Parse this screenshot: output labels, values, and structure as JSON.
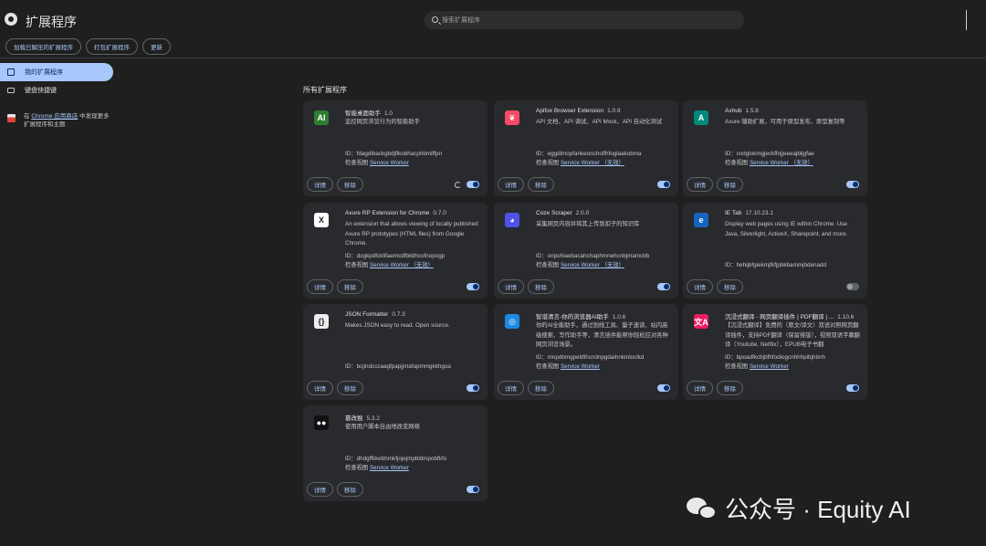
{
  "header": {
    "title": "扩展程序",
    "search_placeholder": "搜索扩展程序"
  },
  "dev_toolbar": {
    "load_unpacked": "加载已解压的扩展程序",
    "pack": "打包扩展程序",
    "update": "更新"
  },
  "sidebar": {
    "items": [
      {
        "label": "我的扩展程序"
      },
      {
        "label": "键盘快捷键"
      }
    ],
    "store_prefix": "在",
    "store_link": "Chrome 应用商店",
    "store_suffix": "中发现更多扩展程序和主题"
  },
  "section_title": "所有扩展程序",
  "labels": {
    "details": "详情",
    "remove": "移除",
    "id_prefix": "ID：",
    "inspect_prefix": "检查视图"
  },
  "extensions": [
    {
      "name": "智能桌面助手",
      "version": "1.0",
      "desc": "监控网页浏览行为的智能助手",
      "id": "fdagdibackgbdjflkobhacphbmiffpn",
      "inspect": "Service Worker",
      "enabled": true,
      "reload": true,
      "icon": "ai-assistant-icon",
      "color": "#2e7d32",
      "glyph": "AI"
    },
    {
      "name": "Apifox Browser Extension",
      "version": "1.0.9",
      "desc": "API 文档、API 调试、API Mock、API 自动化测试",
      "id": "eggdlmopfankeonchoflhfoglaakobma",
      "inspect": "Service Worker （无效）",
      "enabled": true,
      "reload": false,
      "icon": "apifox-icon",
      "color": "#f44a66",
      "glyph": "❦"
    },
    {
      "name": "Axhub",
      "version": "1.5.8",
      "desc": "Axure 辅助扩展，可用于原型发布、原型复制等",
      "id": "cndglokmgjeckffojjeeeajbljgfae",
      "inspect": "Service Worker （无效）",
      "enabled": true,
      "reload": false,
      "icon": "axhub-icon",
      "color": "#00897b",
      "glyph": "A"
    },
    {
      "name": "Axure RP Extension for Chrome",
      "version": "0.7.0",
      "desc": "An extension that allows viewing of locally published Axure RP prototypes (HTML files) from Google Chrome.",
      "id": "dogkpdfcklifaemcdfbildhcofnopogp",
      "inspect": "Service Worker （无效）",
      "enabled": true,
      "reload": false,
      "icon": "axure-icon",
      "color": "#ffffff",
      "glyph": "X"
    },
    {
      "name": "Coze Scraper",
      "version": "2.0.0",
      "desc": "采集网页内容并将其上传到扣子的知识库",
      "id": "onpohiaebacahchaphmnehcnbjmamcbb",
      "inspect": "Service Worker （无效）",
      "enabled": true,
      "reload": false,
      "icon": "coze-icon",
      "color": "#4d53e8",
      "glyph": "◕"
    },
    {
      "name": "IE Tab",
      "version": "17.10.23.1",
      "desc": "Display web pages using IE within Chrome. Use Java, Silverlight, ActiveX, Sharepoint, and more.",
      "id": "hehijbfgiekmjfkfjpbkbammjbdenadd",
      "inspect": "",
      "enabled": false,
      "reload": false,
      "icon": "ie-tab-icon",
      "color": "#1565c0",
      "glyph": "e"
    },
    {
      "name": "JSON Formatter",
      "version": "0.7.3",
      "desc": "Makes JSON easy to read. Open source.",
      "id": "bcjindcccaagfpapjjmafapmmgkkhgoa",
      "inspect": "",
      "enabled": true,
      "reload": false,
      "icon": "json-formatter-icon",
      "color": "#eeeeee",
      "glyph": "{}"
    },
    {
      "name": "智谱清言-你的浏览器AI助手",
      "version": "1.0.6",
      "desc": "你的AI全能助手，通过划线工具、量子速读、站内高级搜索、写作助手等，清言插件能帮你轻松应对各种网页浏览场景。",
      "id": "mnpdbmgpebfihcndnpgdaihnkmloclkd",
      "inspect": "Service Worker",
      "enabled": true,
      "reload": false,
      "icon": "zhipu-icon",
      "color": "#1e88e5",
      "glyph": "◎"
    },
    {
      "name": "沉浸式翻译 - 网页翻译插件 | PDF翻译 | ...",
      "version": "1.10.6",
      "desc": "【沉浸式翻译】免费的（原文/译文）双语对照网页翻译插件，支持PDF翻译（保留排版），视频双语字幕翻译（Youtube, Netflix），EPUB电子书翻",
      "id": "bpoadfkcbjbfhfodiogcnhhhpibjhbnh",
      "inspect": "Service Worker",
      "enabled": true,
      "reload": false,
      "icon": "immersive-translate-icon",
      "color": "#e91e63",
      "glyph": "文A"
    },
    {
      "name": "篡改猴",
      "version": "5.3.2",
      "desc": "使用用户脚本自由地改变网络",
      "id": "dhdgffkkebhmkfjojejmpbldmpobfkfo",
      "inspect": "Service Worker",
      "enabled": true,
      "reload": false,
      "icon": "tampermonkey-icon",
      "color": "#111111",
      "glyph": "●●"
    }
  ],
  "watermark": {
    "text": "公众号 · Equity AI"
  }
}
